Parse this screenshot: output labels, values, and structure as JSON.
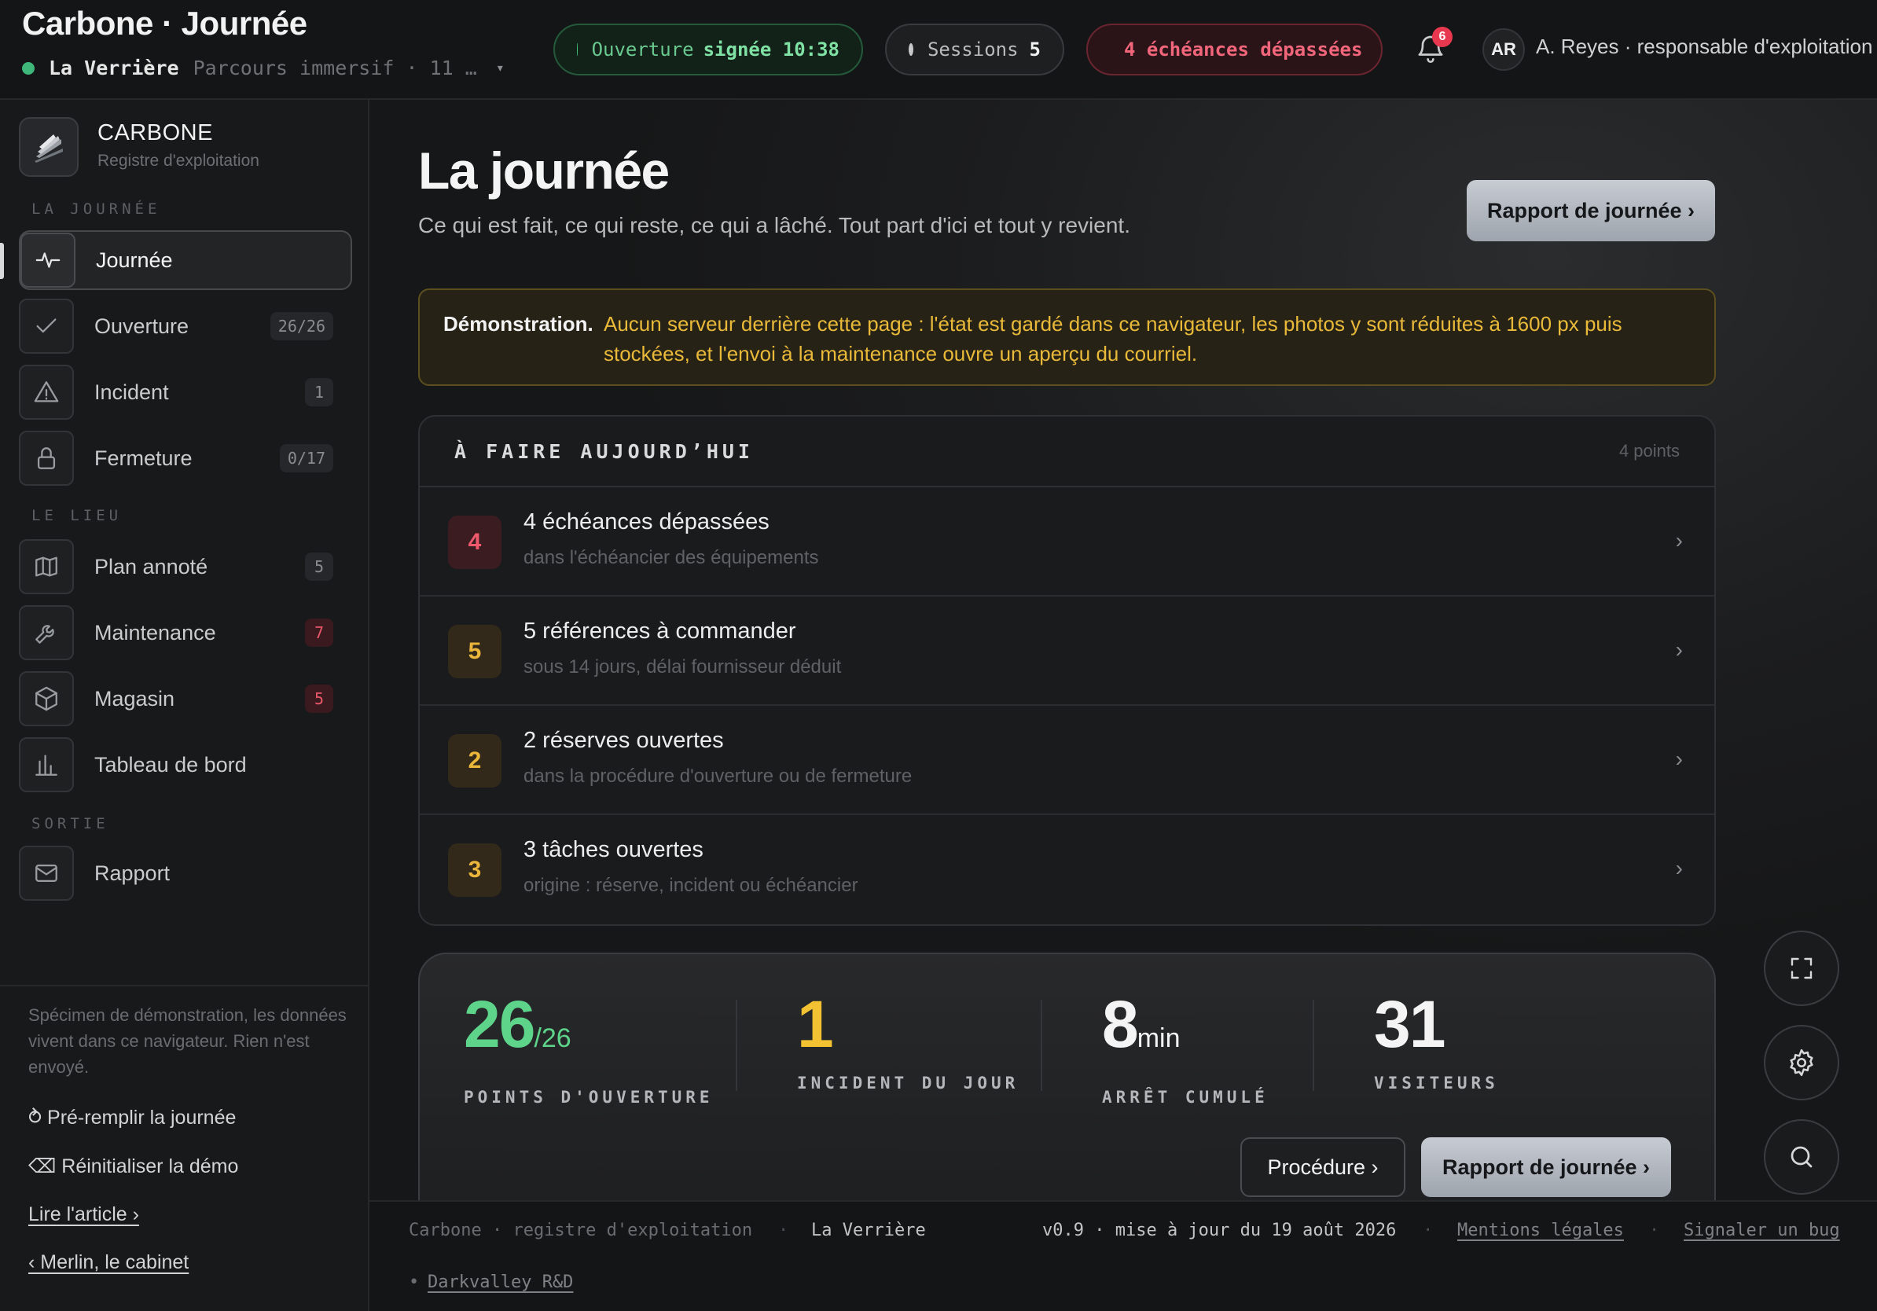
{
  "header": {
    "title": "Carbone · Journée",
    "site": "La Verrière",
    "site_sub": "Parcours immersif · 11 …",
    "caret": "▾",
    "pill_open_label": "Ouverture",
    "pill_open_value": "signée 10:38",
    "pill_sessions_label": "Sessions",
    "pill_sessions_value": "5",
    "pill_late": "4 échéances dépassées",
    "bell_badge": "6",
    "avatar": "AR",
    "user": "A. Reyes · responsable d'exploitation"
  },
  "sidebar": {
    "brand_name": "CARBONE",
    "brand_sub": "Registre d'exploitation",
    "section1": "LA JOURNÉE",
    "section2": "LE LIEU",
    "section3": "SORTIE",
    "items": [
      {
        "label": "Journée",
        "icon": "pulse-icon"
      },
      {
        "label": "Ouverture",
        "count": "26/26",
        "icon": "check-icon"
      },
      {
        "label": "Incident",
        "count": "1",
        "icon": "warning-icon"
      },
      {
        "label": "Fermeture",
        "count": "0/17",
        "icon": "lock-icon"
      },
      {
        "label": "Plan annoté",
        "count": "5",
        "icon": "map-icon"
      },
      {
        "label": "Maintenance",
        "count": "7",
        "icon": "wrench-icon"
      },
      {
        "label": "Magasin",
        "count": "5",
        "icon": "box-icon"
      },
      {
        "label": "Tableau de bord",
        "icon": "bar-chart-icon"
      },
      {
        "label": "Rapport",
        "icon": "mail-icon"
      }
    ],
    "note": "Spécimen de démonstration, les données vivent dans ce navigateur. Rien n'est envoyé.",
    "prefill": "⥁ Pré-remplir la journée",
    "reset": "⌫ Réinitialiser la démo",
    "article": "Lire l'article ›",
    "back": "‹ Merlin, le cabinet"
  },
  "main": {
    "title": "La journée",
    "lead": "Ce qui est fait, ce qui reste, ce qui a lâché. Tout part d'ici et tout y revient.",
    "report_button": "Rapport de journée ›",
    "demo_label": "Démonstration.",
    "demo_text": "Aucun serveur derrière cette page : l'état est gardé dans ce navigateur, les photos y sont réduites à 1600 px puis stockées, et l'envoi à la maintenance ouvre un aperçu du courriel.",
    "todo_title": "À FAIRE AUJOURD’HUI",
    "todo_count": "4 points",
    "todo": [
      {
        "num": "4",
        "title": "4 échéances dépassées",
        "sub": "dans l'échéancier des équipements"
      },
      {
        "num": "5",
        "title": "5 références à commander",
        "sub": "sous 14 jours, délai fournisseur déduit"
      },
      {
        "num": "2",
        "title": "2 réserves ouvertes",
        "sub": "dans la procédure d'ouverture ou de fermeture"
      },
      {
        "num": "3",
        "title": "3 tâches ouvertes",
        "sub": "origine : réserve, incident ou échéancier"
      }
    ],
    "chev": "›",
    "kpis": [
      {
        "value": "26",
        "unit": "/26",
        "label": "POINTS D'OUVERTURE",
        "color": "#5ed38a"
      },
      {
        "value": "1",
        "unit": "",
        "label": "INCIDENT DU JOUR",
        "color": "#f2c233"
      },
      {
        "value": "8",
        "unit": "min",
        "label": "ARRÊT CUMULÉ",
        "color": "#f4f4f4"
      },
      {
        "value": "31",
        "unit": "",
        "label": "VISITEURS",
        "color": "#f4f4f4"
      }
    ],
    "procedure_button": "Procédure ›",
    "report_button_2": "Rapport de journée ›"
  },
  "footer": {
    "app": "Carbone · registre d'exploitation",
    "sep": "·",
    "site": "La Verrière",
    "version": "v0.9 · mise à jour du 19 août 2026",
    "legal": "Mentions légales",
    "bug": "Signaler un bug",
    "studio": "Darkvalley R&D",
    "bullet": "•"
  },
  "colors": {
    "ok": "#3fb67a",
    "alert": "#e8384f",
    "warn": "#e9b93a"
  }
}
